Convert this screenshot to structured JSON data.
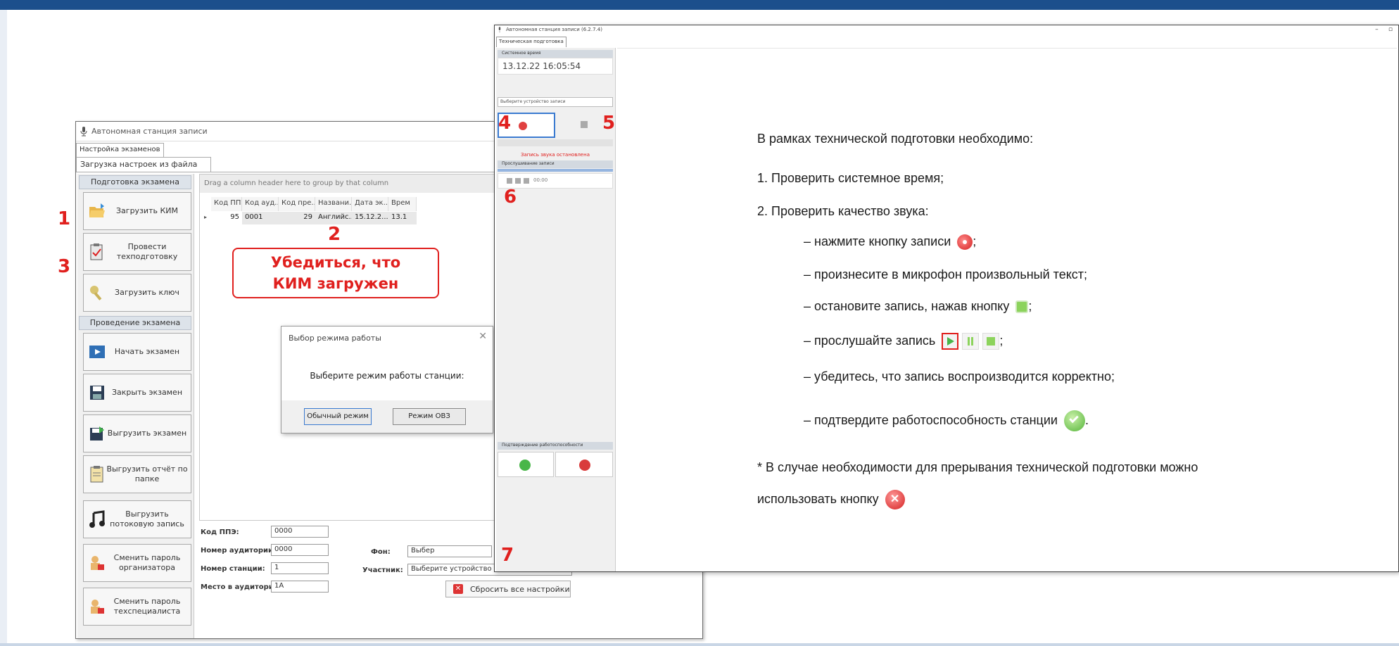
{
  "left_window": {
    "title": "Автономная станция записи",
    "tab": "Настройка экзаменов",
    "subtab": "Загрузка настроек из файла",
    "section_prep": "Подготовка экзамена",
    "section_exam": "Проведение экзамена",
    "buttons": {
      "load_kim": "Загрузить КИМ",
      "tech_prep": "Провести техподготовку",
      "load_key": "Загрузить ключ",
      "start_exam": "Начать экзамен",
      "close_exam": "Закрыть экзамен",
      "unload_exam": "Выгрузить экзамен",
      "unload_report": "Выгрузить отчёт по папке",
      "unload_stream": "Выгрузить потоковую запись",
      "change_org_pwd": "Сменить пароль организатора",
      "change_tech_pwd": "Сменить пароль техспециалиста"
    },
    "grid": {
      "group_hint": "Drag a column header here to group by that column",
      "columns": [
        "Код ППЭ",
        "Код ауд...",
        "Код пре...",
        "Названи...",
        "Дата эк...",
        "Врем"
      ],
      "row": [
        "95",
        "0001",
        "29",
        "Английс...",
        "15.12.2...",
        "13.1"
      ]
    },
    "form": {
      "ppe_label": "Код ППЭ:",
      "ppe_value": "0000",
      "aud_label": "Номер аудитории:",
      "aud_value": "0000",
      "station_label": "Номер станции:",
      "station_value": "1",
      "place_label": "Место в аудитории:",
      "place_value": "1A",
      "bg_label": "Фон:",
      "bg_value": "Выбер",
      "participant_label": "Участник:",
      "participant_value": "Выберите устройство записи участника",
      "reset_label": "Сбросить все настройки"
    }
  },
  "dialog": {
    "title": "Выбор режима работы",
    "message": "Выберите режим работы станции:",
    "normal": "Обычный режим",
    "ovz": "Режим ОВЗ"
  },
  "annotations": {
    "n1": "1",
    "n2": "2",
    "n3": "3",
    "n4": "4",
    "n5": "5",
    "n6": "6",
    "n7": "7",
    "callout_line1": "Убедиться, что",
    "callout_line2": "КИМ загружен"
  },
  "right_window": {
    "title": "Автономная станция записи (6.2.7.4)",
    "tab": "Техническая подготовка",
    "sys_time_label": "Системное время",
    "sys_time": "13.12.22 16:05:54",
    "device_select": "Выберите устройство записи",
    "status": "Запись звука остановлена",
    "playback_label": "Прослушивание записи",
    "play_time": "00:00",
    "confirm_label": "Подтверждение работоспособности"
  },
  "instructions": {
    "intro": "В рамках технической подготовки необходимо:",
    "step1": "1. Проверить системное время;",
    "step2": "2. Проверить качество звука:",
    "b1": "– нажмите кнопку записи",
    "b1_end": ";",
    "b2": "– произнесите в микрофон произвольный текст;",
    "b3": "– остановите запись, нажав кнопку",
    "b3_end": ";",
    "b4": "– прослушайте запись",
    "b4_end": ";",
    "b5": "– убедитесь, что запись воспроизводится корректно;",
    "b6": "– подтвердите работоспособность станции",
    "b6_end": ".",
    "note1": "* В случае необходимости для прерывания технической подготовки можно",
    "note2": "использовать кнопку"
  }
}
